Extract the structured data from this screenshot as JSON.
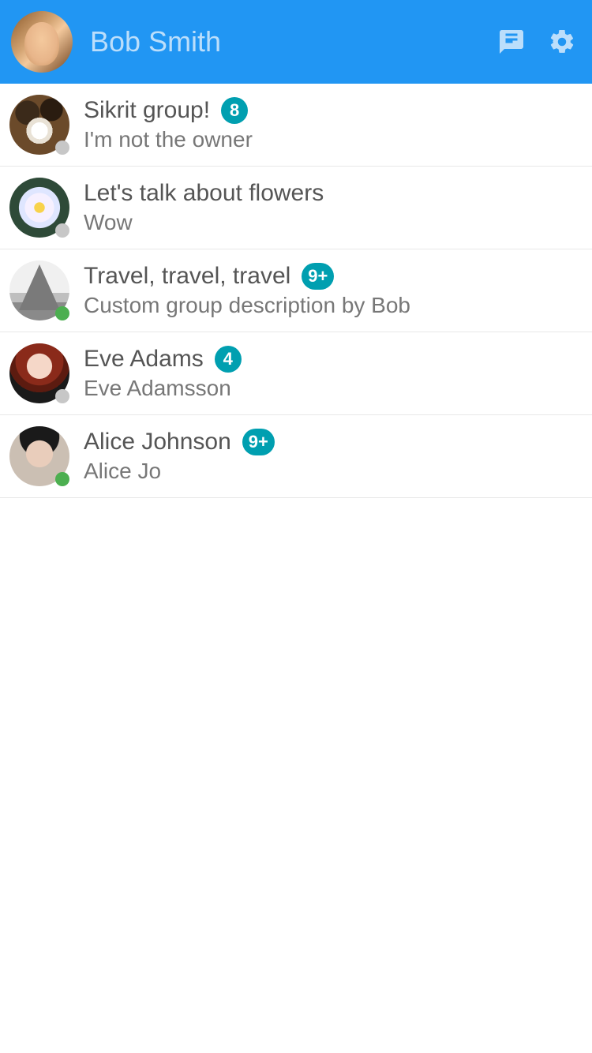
{
  "header": {
    "title": "Bob Smith",
    "icons": {
      "messages": "chat-icon",
      "settings": "gear-icon"
    }
  },
  "badge_color": "#009fb0",
  "chats": [
    {
      "title": "Sikrit group!",
      "subtitle": "I'm not the owner",
      "badge": "8",
      "presence": "offline",
      "avatar": "av-coffee"
    },
    {
      "title": "Let's talk about flowers",
      "subtitle": "Wow",
      "badge": "",
      "presence": "offline",
      "avatar": "av-flower"
    },
    {
      "title": "Travel, travel, travel",
      "subtitle": "Custom group description by Bob",
      "badge": "9+",
      "presence": "online",
      "avatar": "av-travel"
    },
    {
      "title": "Eve Adams",
      "subtitle": "Eve Adamsson",
      "badge": "4",
      "presence": "offline",
      "avatar": "av-eve"
    },
    {
      "title": "Alice Johnson",
      "subtitle": "Alice Jo",
      "badge": "9+",
      "presence": "online",
      "avatar": "av-alice"
    }
  ]
}
